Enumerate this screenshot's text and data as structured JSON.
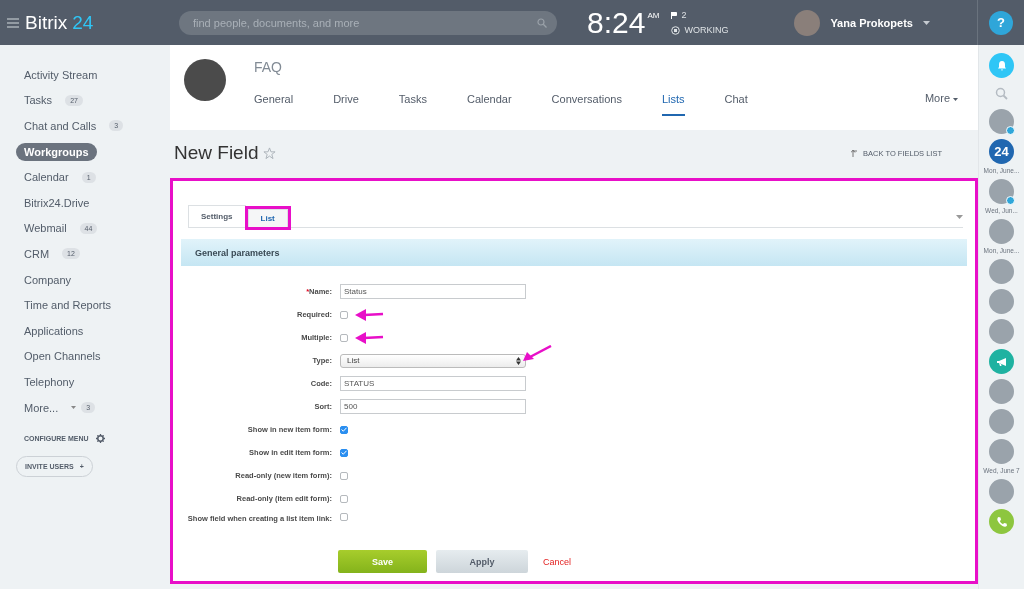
{
  "top_bar": {
    "logo_text": "Bitrix",
    "logo_number": "24",
    "search": {
      "placeholder": "find people, documents, and more"
    },
    "time": "8:24",
    "meridiem": "AM",
    "flag_count": "2",
    "status": "WORKING",
    "user_name": "Yana Prokopets",
    "help": "?"
  },
  "sidebar": {
    "items": [
      {
        "label": "Activity Stream",
        "selected": false
      },
      {
        "label": "Tasks",
        "count": "27",
        "selected": false
      },
      {
        "label": "Chat and Calls",
        "count": "3",
        "selected": false
      },
      {
        "label": "Workgroups",
        "selected": true
      },
      {
        "label": "Calendar",
        "count": "1",
        "selected": false
      },
      {
        "label": "Bitrix24.Drive",
        "selected": false
      },
      {
        "label": "Webmail",
        "count": "44",
        "selected": false
      },
      {
        "label": "CRM",
        "count": "12",
        "selected": false
      },
      {
        "label": "Company",
        "selected": false
      },
      {
        "label": "Time and Reports",
        "selected": false
      },
      {
        "label": "Applications",
        "selected": false
      },
      {
        "label": "Open Channels",
        "selected": false
      },
      {
        "label": "Telephony",
        "selected": false
      },
      {
        "label": "More...",
        "count": "3",
        "dropdown": true,
        "selected": false
      }
    ],
    "configure": "CONFIGURE MENU",
    "invite": "INVITE USERS",
    "invite_icon": "+"
  },
  "group": {
    "title": "FAQ",
    "tabs": [
      {
        "label": "General",
        "selected": false
      },
      {
        "label": "Drive",
        "selected": false
      },
      {
        "label": "Tasks",
        "selected": false
      },
      {
        "label": "Calendar",
        "selected": false
      },
      {
        "label": "Conversations",
        "selected": false
      },
      {
        "label": "Lists",
        "selected": true
      },
      {
        "label": "Chat",
        "selected": false
      }
    ],
    "more": "More"
  },
  "page": {
    "title": "New Field",
    "back_link": "BACK TO FIELDS LIST"
  },
  "form": {
    "tabs": [
      {
        "label": "Settings",
        "selected": true,
        "annotated": false
      },
      {
        "label": "List",
        "selected": false,
        "annotated": true
      }
    ],
    "section_title": "General parameters",
    "fields": [
      {
        "kind": "text",
        "marker": "*",
        "label": "Name:",
        "value": "Status",
        "annotated": false
      },
      {
        "kind": "checkbox",
        "label": "Required:",
        "checked": false,
        "annotated": true
      },
      {
        "kind": "checkbox",
        "label": "Multiple:",
        "checked": false,
        "annotated": true
      },
      {
        "kind": "select",
        "label": "Type:",
        "value": "List",
        "annotated": true
      },
      {
        "kind": "text",
        "label": "Code:",
        "value": "STATUS",
        "annotated": false
      },
      {
        "kind": "text",
        "label": "Sort:",
        "value": "500",
        "annotated": false
      },
      {
        "kind": "checkbox",
        "label": "Show in new item form:",
        "checked": true,
        "annotated": false
      },
      {
        "kind": "checkbox",
        "label": "Show in edit item form:",
        "checked": true,
        "annotated": false
      },
      {
        "kind": "checkbox",
        "label": "Read-only (new item form):",
        "checked": false,
        "annotated": false
      },
      {
        "kind": "checkbox",
        "label": "Read-only (item edit form):",
        "checked": false,
        "annotated": false
      },
      {
        "kind": "checkbox",
        "label": "Show field when creating a list item link:",
        "checked": false,
        "annotated": false
      }
    ],
    "buttons": [
      {
        "kind": "primary",
        "label": "Save"
      },
      {
        "kind": "secondary",
        "label": "Apply"
      },
      {
        "kind": "link",
        "label": "Cancel"
      }
    ]
  },
  "right_panel": {
    "items": [
      {
        "kind": "bell"
      },
      {
        "kind": "search"
      },
      {
        "kind": "avatar",
        "badge": true
      },
      {
        "kind": "logo",
        "text": "24",
        "date": "Mon, June..."
      },
      {
        "kind": "avatar",
        "badge": true,
        "date": "Wed, Jun..."
      },
      {
        "kind": "avatar",
        "badge": false,
        "date": "Mon, June..."
      },
      {
        "kind": "avatar",
        "badge": false
      },
      {
        "kind": "avatar",
        "badge": false
      },
      {
        "kind": "avatar",
        "badge": false
      },
      {
        "kind": "megaphone"
      },
      {
        "kind": "avatar",
        "badge": false
      },
      {
        "kind": "avatar",
        "badge": false
      },
      {
        "kind": "avatar",
        "badge": false,
        "date": "Wed, June 7"
      },
      {
        "kind": "avatar",
        "badge": false
      },
      {
        "kind": "phone"
      }
    ]
  }
}
